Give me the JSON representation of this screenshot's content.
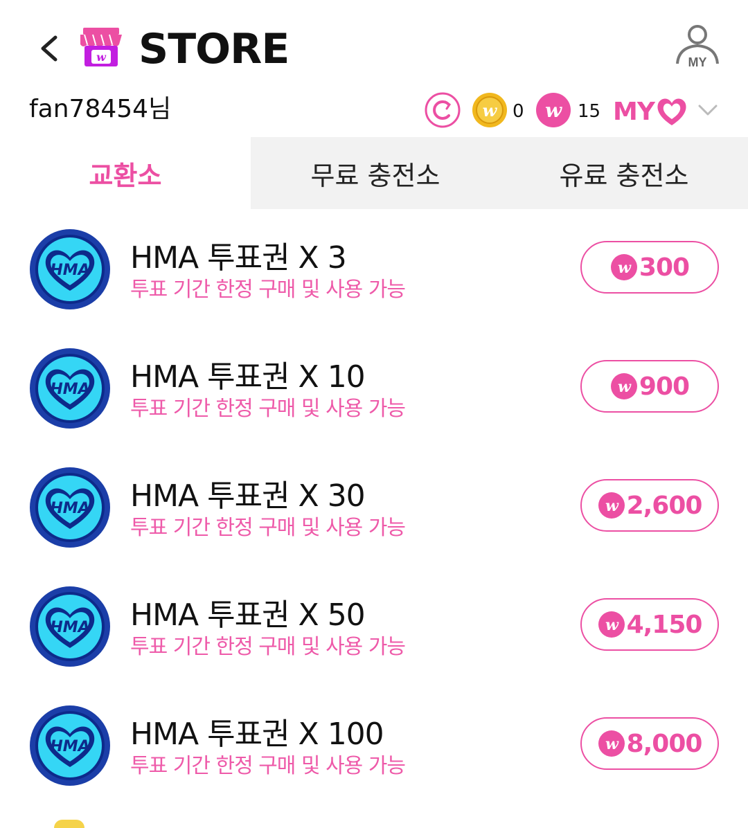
{
  "header": {
    "title": "STORE",
    "my_button_label": "MY"
  },
  "user": {
    "name": "fan78454님",
    "gold_coin_count": "0",
    "w_coin_count": "15",
    "my_label": "MY"
  },
  "tabs": [
    {
      "label": "교환소",
      "active": true
    },
    {
      "label": "무료 충전소",
      "active": false
    },
    {
      "label": "유료 충전소",
      "active": false
    }
  ],
  "items": [
    {
      "name": "HMA 투표권 X 3",
      "subtitle": "투표 기간 한정 구매 및 사용 가능",
      "price": "300",
      "icon_text": "HMA"
    },
    {
      "name": "HMA 투표권 X 10",
      "subtitle": "투표 기간 한정 구매 및 사용 가능",
      "price": "900",
      "icon_text": "HMA"
    },
    {
      "name": "HMA 투표권 X 30",
      "subtitle": "투표 기간 한정 구매 및 사용 가능",
      "price": "2,600",
      "icon_text": "HMA"
    },
    {
      "name": "HMA 투표권 X 50",
      "subtitle": "투표 기간 한정 구매 및 사용 가능",
      "price": "4,150",
      "icon_text": "HMA"
    },
    {
      "name": "HMA 투표권 X 100",
      "subtitle": "투표 기간 한정 구매 및 사용 가능",
      "price": "8,000",
      "icon_text": "HMA"
    }
  ],
  "colors": {
    "accent": "#ec4fa3",
    "tab_inactive_bg": "#f2f2f2",
    "gold": "#f1b81e",
    "icon_blue": "#1b3ea8",
    "icon_cyan": "#35d6f5"
  },
  "icons": {
    "back": "chevron-left-icon",
    "store": "store-awning-icon",
    "my": "user-profile-icon",
    "refresh": "refresh-c-icon",
    "gold": "gold-w-coin-icon",
    "w": "pink-w-coin-icon",
    "heart": "heart-icon",
    "dropdown": "chevron-down-icon"
  }
}
